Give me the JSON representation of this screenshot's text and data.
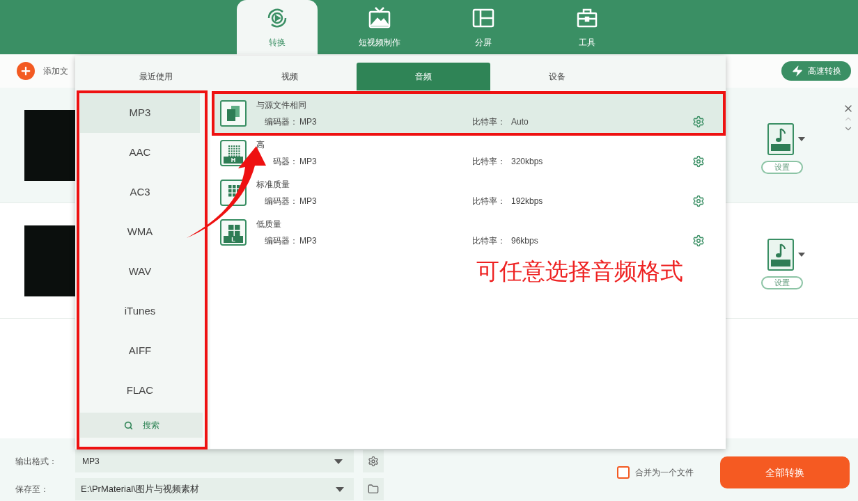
{
  "top_tabs": [
    {
      "label": "转换",
      "selected": true,
      "kind": "convert"
    },
    {
      "label": "短视频制作",
      "selected": false,
      "kind": "tv"
    },
    {
      "label": "分屏",
      "selected": false,
      "kind": "split"
    },
    {
      "label": "工具",
      "selected": false,
      "kind": "toolbox"
    }
  ],
  "toolbar": {
    "add_files": "添加文",
    "fast_convert": "高速转换"
  },
  "files": [
    {
      "hovered": true,
      "settings_button": "设置"
    },
    {
      "hovered": false,
      "settings_button": "设置"
    }
  ],
  "popup": {
    "tabs": [
      {
        "label": "最近使用",
        "selected": false
      },
      {
        "label": "视频",
        "selected": false
      },
      {
        "label": "音频",
        "selected": true
      },
      {
        "label": "设备",
        "selected": false
      }
    ],
    "formats": [
      {
        "label": "MP3",
        "selected": true
      },
      {
        "label": "AAC",
        "selected": false
      },
      {
        "label": "AC3",
        "selected": false
      },
      {
        "label": "WMA",
        "selected": false
      },
      {
        "label": "WAV",
        "selected": false
      },
      {
        "label": "iTunes",
        "selected": false
      },
      {
        "label": "AIFF",
        "selected": false
      },
      {
        "label": "FLAC",
        "selected": false
      }
    ],
    "search": "搜索",
    "presets": [
      {
        "kind": "same",
        "title": "与源文件相同",
        "codec_label": "编码器：",
        "codec": "MP3",
        "bitrate_label": "比特率：",
        "bitrate": "Auto",
        "selected": true
      },
      {
        "kind": "quality",
        "badge": "H",
        "title": "高",
        "codec_label": "码器：",
        "codec": "MP3",
        "bitrate_label": "比特率：",
        "bitrate": "320kbps",
        "selected": false
      },
      {
        "kind": "quality",
        "title": "标准质量",
        "codec_label": "编码器：",
        "codec": "MP3",
        "bitrate_label": "比特率：",
        "bitrate": "192kbps",
        "selected": false
      },
      {
        "kind": "quality",
        "badge": "L",
        "title": "低质量",
        "codec_label": "编码器：",
        "codec": "MP3",
        "bitrate_label": "比特率：",
        "bitrate": "96kbps",
        "selected": false
      }
    ]
  },
  "annotation": {
    "caption": "可任意选择音频格式"
  },
  "bottom": {
    "output_format_label": "输出格式：",
    "output_format": "MP3",
    "save_to_label": "保存至：",
    "save_path": "E:\\PrMaterial\\图片与视频素材",
    "merge": {
      "label": "合并为一个文件",
      "checked": false
    },
    "convert_all": "全部转换"
  }
}
